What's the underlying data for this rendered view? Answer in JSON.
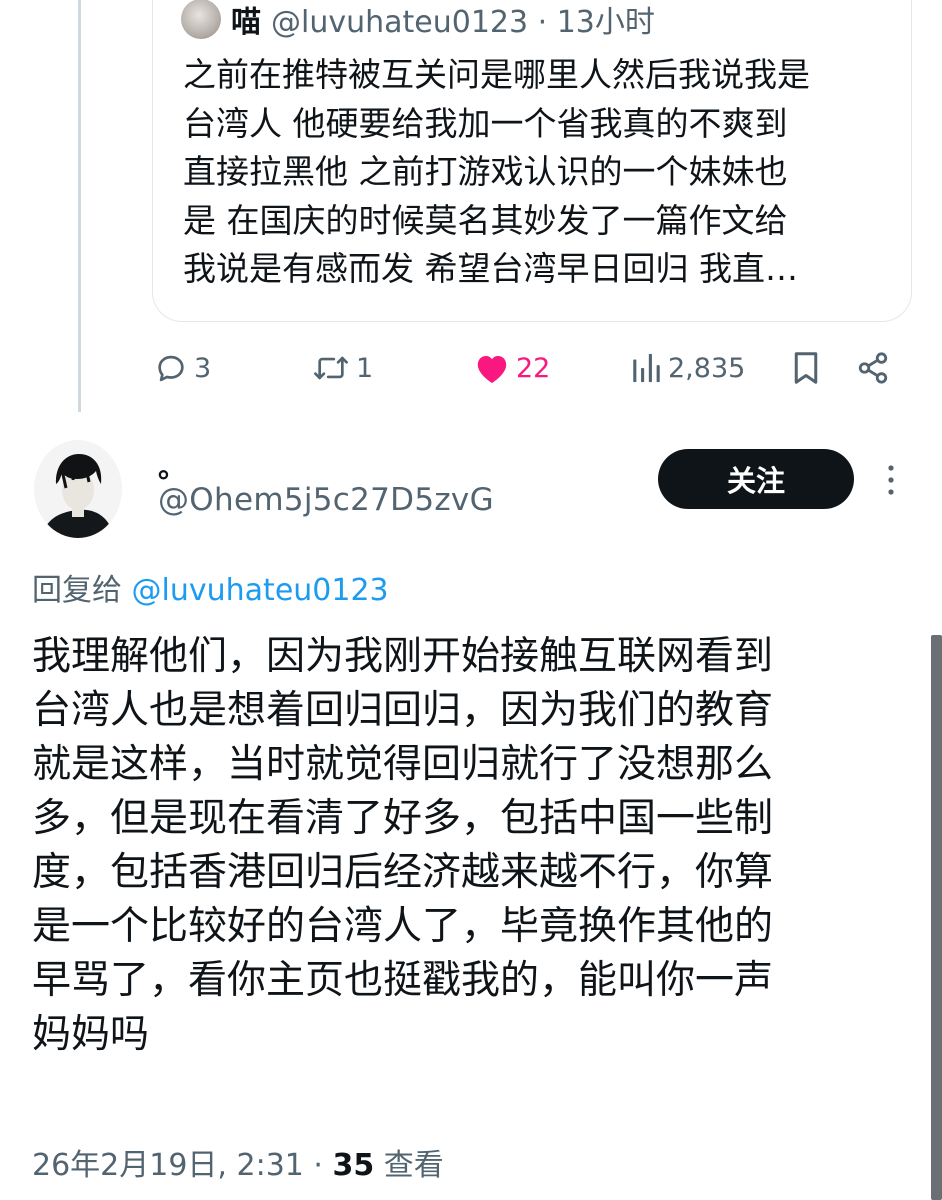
{
  "quoted_tweet": {
    "name": "喵",
    "handle": "@luvuhateu0123 · 13小时",
    "text_lines": [
      "之前在推特被互关问是哪里人然后我说我是",
      "台湾人 他硬要给我加一个省我真的不爽到",
      "直接拉黑他 之前打游戏认识的一个妹妹也",
      "是 在国庆的时候莫名其妙发了一篇作文给",
      "我说是有感而发 希望台湾早日回归 我直…"
    ]
  },
  "actions": {
    "replies": "3",
    "reposts": "1",
    "likes": "22",
    "views": "2,835",
    "like_color": "#f91880",
    "icon_color": "#536471"
  },
  "author": {
    "name": "。",
    "handle": "@Ohem5j5c27D5zvG",
    "follow_label": "关注"
  },
  "reply": {
    "prefix": "回复给 ",
    "mention": "@luvuhateu0123"
  },
  "tweet": {
    "text_lines": [
      "我理解他们，因为我刚开始接触互联网看到",
      "台湾人也是想着回归回归，因为我们的教育",
      "就是这样，当时就觉得回归就行了没想那么",
      "多，但是现在看清了好多，包括中国一些制",
      "度，包括香港回归后经济越来越不行，你算",
      "是一个比较好的台湾人了，毕竟换作其他的",
      "早骂了，看你主页也挺戳我的，能叫你一声",
      "妈妈吗"
    ],
    "timestamp": "26年2月19日, 2:31 · ",
    "views_count": "35",
    "views_label": " 查看"
  },
  "colors": {
    "accent": "#1d9bf0",
    "text_primary": "#0f1419",
    "text_secondary": "#536471",
    "follow_bg": "#0f1419"
  }
}
